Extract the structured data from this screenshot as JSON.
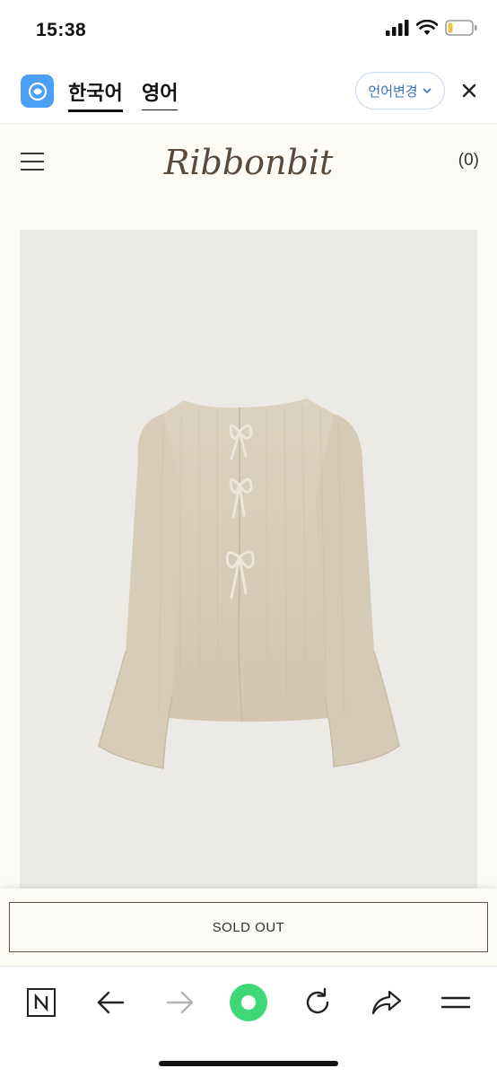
{
  "status_bar": {
    "time": "15:38",
    "icons": [
      "signal-icon",
      "wifi-icon",
      "battery-icon"
    ]
  },
  "translate_bar": {
    "app_icon": "papago-icon",
    "languages": [
      {
        "label": "한국어",
        "selected": true
      },
      {
        "label": "영어",
        "selected": false
      }
    ],
    "change_language_label": "언어변경",
    "close_icon": "close-icon"
  },
  "site_header": {
    "menu_icon": "hamburger-menu-icon",
    "logo_text": "Ribbonbit",
    "cart_label": "(0)"
  },
  "product": {
    "image_description_icon": "cardigan-product-image",
    "colors": {
      "garment": "#d9ccb8",
      "background": "#eceae5"
    }
  },
  "purchase": {
    "sold_out_label": "SOLD OUT"
  },
  "browser_nav": {
    "items": [
      "naver-icon",
      "back-arrow-icon",
      "forward-arrow-icon",
      "home-green-icon",
      "refresh-icon",
      "share-icon",
      "menu-icon"
    ]
  },
  "colors": {
    "page_bg": "#fdfbf6",
    "accent_blue": "#3b6fbf",
    "green_button": "#3ed877"
  }
}
